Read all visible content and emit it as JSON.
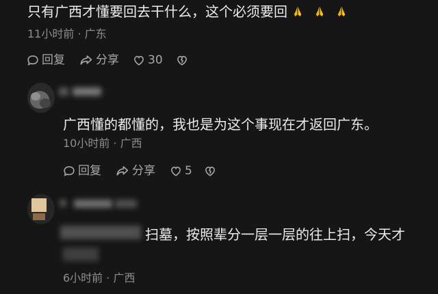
{
  "comments": [
    {
      "text": "只有广西才懂要回去干什么，这个必须要回",
      "meta": "11小时前 · 广东",
      "reply_label": "回复",
      "share_label": "分享",
      "like_count": "30"
    },
    {
      "text": "广西懂的都懂的，我也是为这个事现在才返回广东。",
      "meta": "10小时前 · 广西",
      "reply_label": "回复",
      "share_label": "分享",
      "like_count": "5"
    },
    {
      "text": "扫墓，按照辈分一层一层的往上扫，今天才",
      "meta": "6小时前 · 广西"
    }
  ],
  "colors": {
    "background": "#161616",
    "text": "#ededed",
    "meta": "#8e8e8e",
    "action": "#a8a8a8",
    "emoji": "#f0b400"
  },
  "icons": {
    "reply": "reply-icon",
    "share": "share-icon",
    "like": "heart-icon",
    "dislike": "broken-heart-icon",
    "pray": "pray-emoji-icon"
  }
}
